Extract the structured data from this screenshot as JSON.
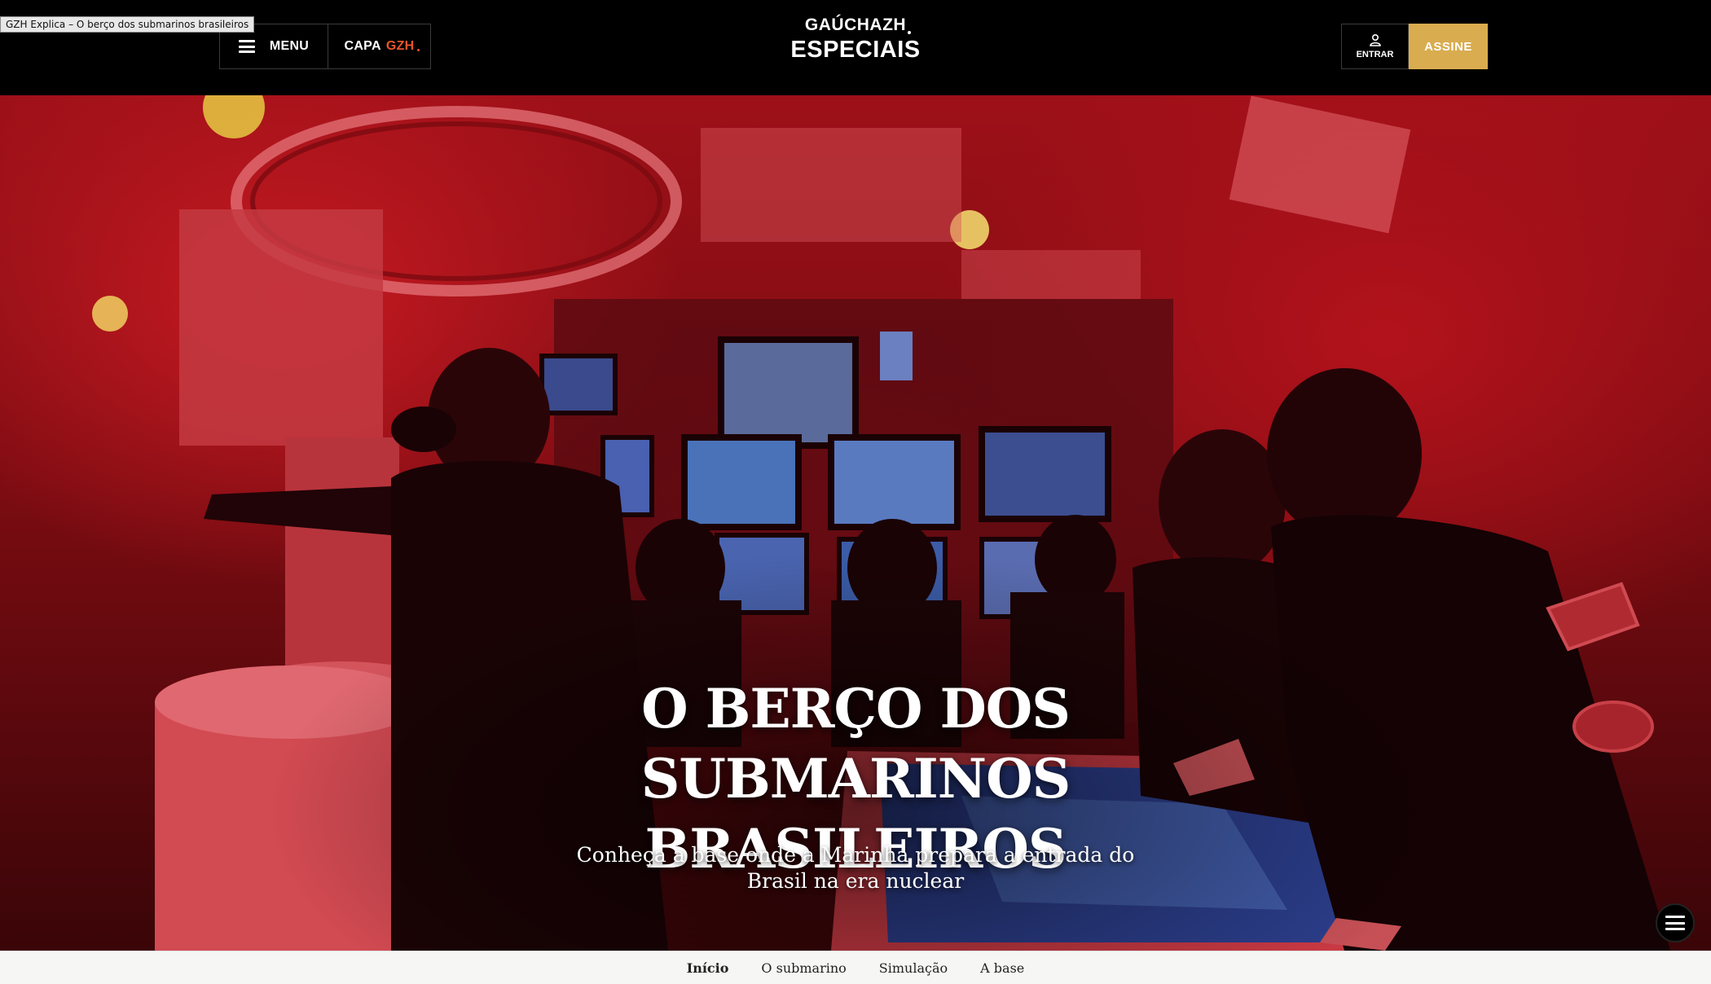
{
  "tab": {
    "tooltip": "GZH Explica – O berço dos submarinos brasileiros"
  },
  "header": {
    "menu_label": "MENU",
    "capa_label": "CAPA",
    "capa_brand": "GZH",
    "logo_top": "GAÚCHAZH",
    "logo_bottom": "ESPECIAIS",
    "entrar_label": "ENTRAR",
    "assine_label": "ASSINE"
  },
  "hero": {
    "title": "O BERÇO DOS SUBMARINOS BRASILEIROS",
    "subtitle": "Conheça a base onde a Marinha prepara a entrada do Brasil na era nuclear"
  },
  "nav": {
    "items": [
      {
        "label": "Início",
        "active": true
      },
      {
        "label": "O submarino",
        "active": false
      },
      {
        "label": "Simulação",
        "active": false
      },
      {
        "label": "A base",
        "active": false
      }
    ]
  },
  "colors": {
    "accent": "#d9ac4f",
    "brand_orange": "#e8552b",
    "hero_red": "#b3121b"
  }
}
